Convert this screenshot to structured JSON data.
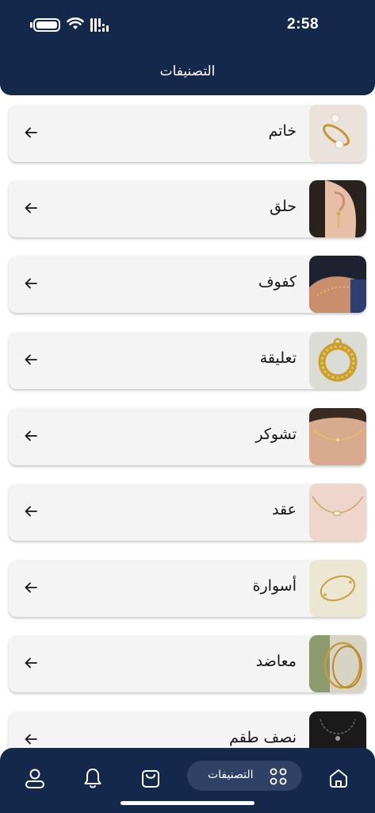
{
  "status_bar": {
    "time": "2:58"
  },
  "header": {
    "title": "التصنيفات"
  },
  "categories": [
    {
      "label": "خاتم",
      "image": "ring-image"
    },
    {
      "label": "حلق",
      "image": "earring-image"
    },
    {
      "label": "كفوف",
      "image": "hand-chain-image"
    },
    {
      "label": "تعليقة",
      "image": "pendant-image"
    },
    {
      "label": "تشوكر",
      "image": "choker-image"
    },
    {
      "label": "عقد",
      "image": "necklace-image"
    },
    {
      "label": "أسوارة",
      "image": "bracelet-image"
    },
    {
      "label": "معاضد",
      "image": "bangle-image"
    },
    {
      "label": "نصف طقم",
      "image": "half-set-image"
    }
  ],
  "bottom_nav": {
    "items": [
      {
        "icon": "home-icon"
      },
      {
        "icon": "categories-icon",
        "label": "التصنيفات",
        "active": true
      },
      {
        "icon": "cart-icon"
      },
      {
        "icon": "bell-icon"
      },
      {
        "icon": "profile-icon"
      }
    ]
  },
  "colors": {
    "header": "#14284b",
    "card": "#f4f4f4",
    "nav_active": "#2f4164"
  }
}
